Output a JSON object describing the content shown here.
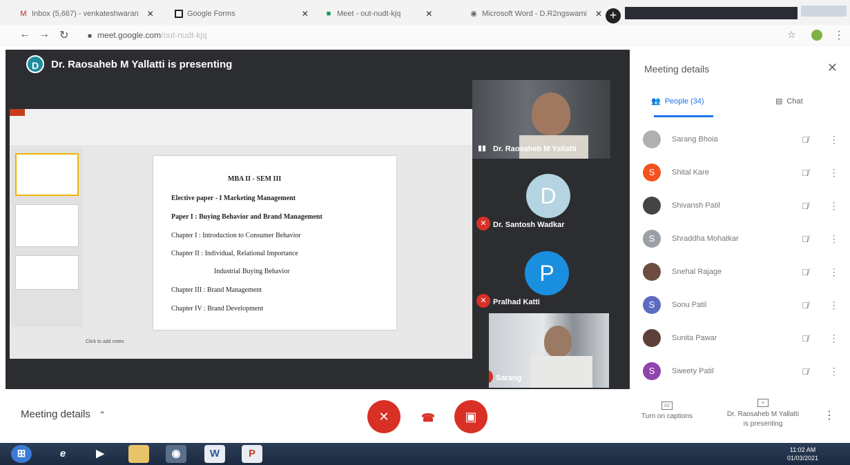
{
  "browser": {
    "tabs": [
      {
        "label": "Inbox (5,667) - venkateshwaran",
        "icon": "gmail-icon"
      },
      {
        "label": "Google Forms",
        "icon": "forms-icon"
      },
      {
        "label": "Meet - out-nudt-kjq",
        "icon": "meet-icon"
      },
      {
        "label": "Microsoft Word - D.R2ngswami",
        "icon": "word-icon"
      }
    ],
    "new_tab": "+",
    "url_host": "meet.google.com",
    "url_path": "/out-nudt-kjq"
  },
  "stage": {
    "presenter_initial": "D",
    "presenter_text": "Dr. Raosaheb M Yallatti is presenting"
  },
  "slide": {
    "title": "MBA II - SEM III",
    "line1": "Elective paper - I Marketing Management",
    "line2": "Paper I : Buying Behavior and Brand Management",
    "line3": "Chapter I : Introduction to Consumer Behavior",
    "line4": "Chapter II : Individual, Relational Importance",
    "line5": "Industrial Buying Behavior",
    "line6": "Chapter III : Brand Management",
    "line7": "Chapter IV : Brand Development",
    "status": "Click to add notes"
  },
  "tiles": [
    {
      "name": "Dr. Raosaheb M Yallatti",
      "type": "video"
    },
    {
      "name": "Dr. Santosh Wadkar",
      "initial": "D",
      "color": "#b3d4e0"
    },
    {
      "name": "Pralhad Katti",
      "initial": "P",
      "color": "#1a8fe0"
    },
    {
      "name": "Sarang",
      "type": "video"
    }
  ],
  "panel": {
    "title": "Meeting details",
    "tab_people": "People (34)",
    "tab_chat": "Chat",
    "people": [
      {
        "name": "Sarang Bhoia",
        "initial": "",
        "color": "#9e9e9e"
      },
      {
        "name": "Shital Kare",
        "initial": "S",
        "color": "#f4511e"
      },
      {
        "name": "Shivansh Patil",
        "initial": "",
        "color": "#444444"
      },
      {
        "name": "Shraddha Mohatkar",
        "initial": "S",
        "color": "#9aa0a6"
      },
      {
        "name": "Snehal Rajage",
        "initial": "",
        "color": "#6d4c41"
      },
      {
        "name": "Sonu Patil",
        "initial": "S",
        "color": "#5c6bc0"
      },
      {
        "name": "Sunita Pawar",
        "initial": "",
        "color": "#5d4037"
      },
      {
        "name": "Sweety Patil",
        "initial": "S",
        "color": "#8e44ad"
      }
    ]
  },
  "controls": {
    "meeting_details": "Meeting details",
    "captions": "Turn on captions",
    "presenting_line1": "Dr. Raosaheb M Yallatti",
    "presenting_line2": "is presenting"
  },
  "taskbar": {
    "time": "11:02 AM",
    "date": "01/03/2021"
  }
}
